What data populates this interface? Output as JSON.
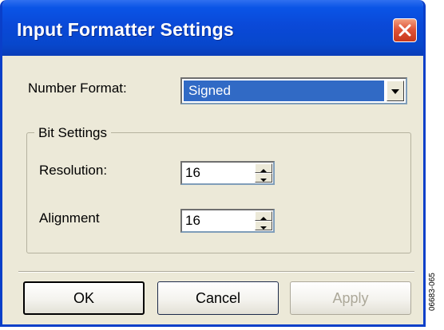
{
  "window": {
    "title": "Input Formatter Settings",
    "icons": {
      "close": "close-icon"
    },
    "colors": {
      "titlebar": "#0a49d8",
      "frame": "#ece9d8",
      "close": "#e0553a",
      "selection": "#316ac5"
    }
  },
  "number_format": {
    "label": "Number Format:",
    "value": "Signed",
    "icon": "chevron-down-icon"
  },
  "bit_settings": {
    "title": "Bit Settings",
    "resolution": {
      "label": "Resolution:",
      "value": "16"
    },
    "alignment": {
      "label": "Alignment",
      "value": "16"
    }
  },
  "buttons": {
    "ok": "OK",
    "cancel": "Cancel",
    "apply": "Apply"
  },
  "figure_id": "06683-065"
}
